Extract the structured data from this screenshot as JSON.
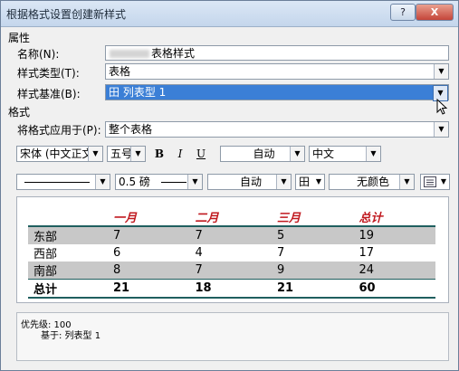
{
  "window": {
    "title": "根据格式设置创建新样式",
    "help_label": "?",
    "close_label": "X"
  },
  "properties": {
    "section_label": "属性",
    "name_label": "名称(N):",
    "name_value": "表格样式",
    "type_label": "样式类型(T):",
    "type_value": "表格",
    "based_on_label": "样式基准(B):",
    "based_on_value": "田 列表型 1"
  },
  "format": {
    "section_label": "格式",
    "apply_to_label": "将格式应用于(P):",
    "apply_to_value": "整个表格",
    "font_value": "宋体 (中文正文)",
    "size_value": "五号",
    "bold": "B",
    "italic": "I",
    "underline": "U",
    "font_color": "自动",
    "language": "中文",
    "line_weight": "0.5 磅",
    "border_color": "自动",
    "border_grid": "田",
    "shading": "无颜色"
  },
  "preview": {
    "headers": [
      "",
      "一月",
      "二月",
      "三月",
      "总计"
    ],
    "rows": [
      [
        "东部",
        "7",
        "7",
        "5",
        "19"
      ],
      [
        "西部",
        "6",
        "4",
        "7",
        "17"
      ],
      [
        "南部",
        "8",
        "7",
        "9",
        "24"
      ],
      [
        "总计",
        "21",
        "18",
        "21",
        "60"
      ]
    ]
  },
  "description": {
    "priority": "优先级: 100",
    "based_on": "基于: 列表型 1"
  },
  "colors": {
    "selection": "#3b7fd6",
    "header_text": "#c0191f",
    "rule": "#1f5f5f",
    "shade": "#c8c8c8"
  }
}
